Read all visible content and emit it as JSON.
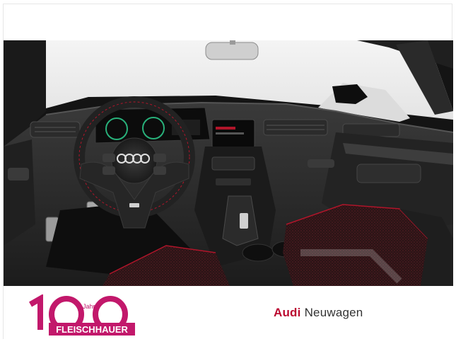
{
  "listing": {
    "image_alt": "Audi A3 interior cockpit view",
    "brand_logo": {
      "big_text": "100",
      "small_text": "Jahre",
      "banner_text": "FLEISCHHAUER"
    },
    "dealer_line": {
      "brand": "Audi",
      "category": "Neuwagen"
    }
  },
  "colors": {
    "brand_red": "#bb0a30",
    "logo_pink": "#c2186b",
    "stitch_red": "#b0152a",
    "interior_dark": "#141414"
  },
  "icons": [
    "audi-rings-icon"
  ]
}
